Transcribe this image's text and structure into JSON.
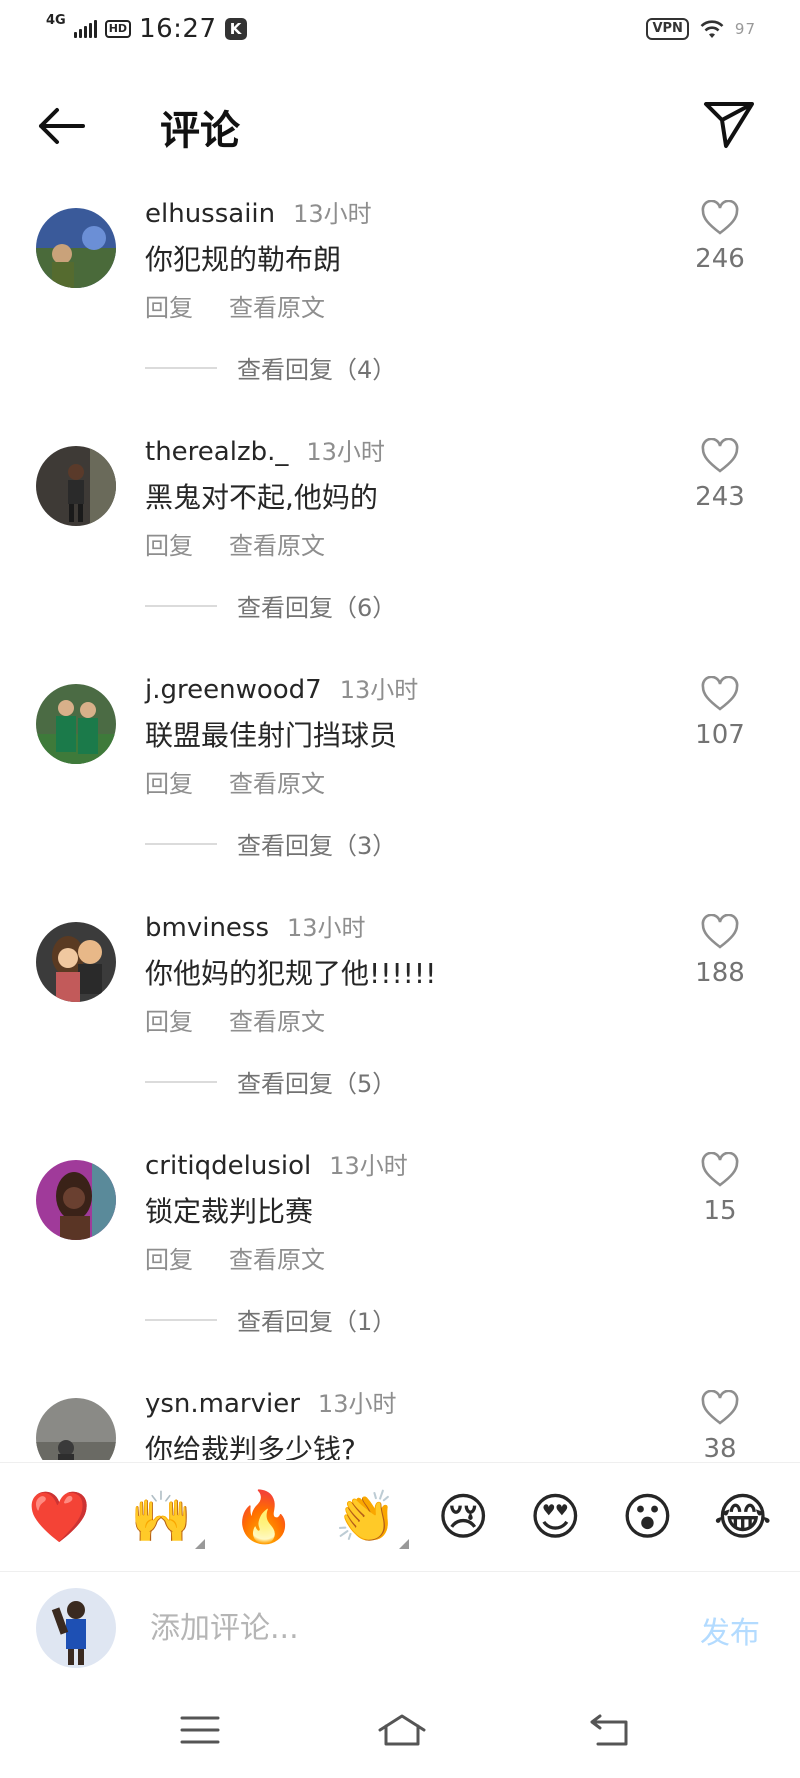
{
  "status_bar": {
    "network": "4G",
    "hd": "HD",
    "time": "16:27",
    "k_badge": "K",
    "vpn": "VPN",
    "battery": "97"
  },
  "header": {
    "title": "评论",
    "back_icon": "arrow-left-icon",
    "send_icon": "paper-plane-icon"
  },
  "comments": [
    {
      "username": "elhussaiin",
      "time": "13小时",
      "text": "你犯规的勒布朗",
      "reply": "回复",
      "translate": "查看原文",
      "likes": "246",
      "view_replies": "查看回复（4）"
    },
    {
      "username": "therealzb._",
      "time": "13小时",
      "text": "黑鬼对不起,他妈的",
      "reply": "回复",
      "translate": "查看原文",
      "likes": "243",
      "view_replies": "查看回复（6）"
    },
    {
      "username": "j.greenwood7",
      "time": "13小时",
      "text": "联盟最佳射门挡球员",
      "reply": "回复",
      "translate": "查看原文",
      "likes": "107",
      "view_replies": "查看回复（3）"
    },
    {
      "username": "bmviness",
      "time": "13小时",
      "text": "你他妈的犯规了他!!!!!!",
      "reply": "回复",
      "translate": "查看原文",
      "likes": "188",
      "view_replies": "查看回复（5）"
    },
    {
      "username": "critiqdelusiol",
      "time": "13小时",
      "text": "锁定裁判比赛",
      "reply": "回复",
      "translate": "查看原文",
      "likes": "15",
      "view_replies": "查看回复（1）"
    },
    {
      "username": "ysn.marvier",
      "time": "13小时",
      "text": "你给裁判多少钱?",
      "likes": "38"
    }
  ],
  "emoji_bar": [
    "❤️",
    "🙌",
    "🔥",
    "👏",
    "😢",
    "😍",
    "😮",
    "😂"
  ],
  "composer": {
    "placeholder": "添加评论...",
    "post_label": "发布"
  },
  "colors": {
    "text": "#262626",
    "secondary": "#8e8e8e",
    "post_disabled": "#b3dbff"
  }
}
